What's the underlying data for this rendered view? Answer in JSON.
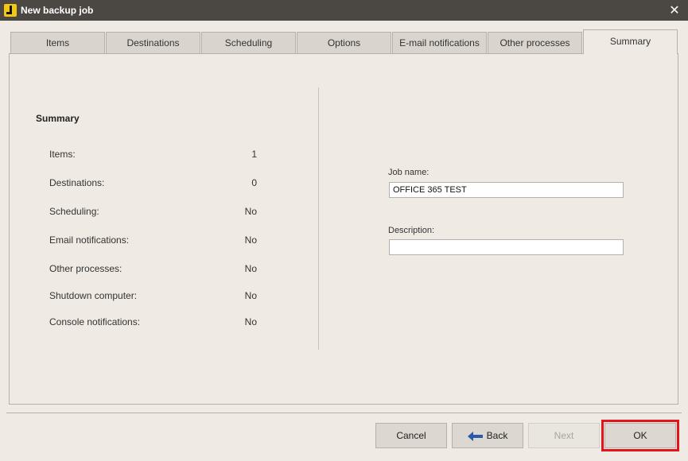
{
  "window": {
    "title": "New backup job",
    "close_glyph": "✕"
  },
  "tabs": [
    {
      "label": "Items"
    },
    {
      "label": "Destinations"
    },
    {
      "label": "Scheduling"
    },
    {
      "label": "Options"
    },
    {
      "label": "E-mail notifications"
    },
    {
      "label": "Other processes"
    },
    {
      "label": "Summary",
      "active": true
    }
  ],
  "summary": {
    "title": "Summary",
    "rows": [
      {
        "label": "Items:",
        "value": "1"
      },
      {
        "label": "Destinations:",
        "value": "0"
      },
      {
        "label": "Scheduling:",
        "value": "No"
      },
      {
        "label": "Email notifications:",
        "value": "No"
      },
      {
        "label": "Other processes:",
        "value": "No"
      },
      {
        "label": "Shutdown computer:",
        "value": "No"
      },
      {
        "label": "Console notifications:",
        "value": "No"
      }
    ]
  },
  "job": {
    "name_label": "Job name:",
    "name_value": "OFFICE 365 TEST",
    "description_label": "Description:",
    "description_value": ""
  },
  "buttons": {
    "cancel": "Cancel",
    "back": "Back",
    "next": "Next",
    "ok": "OK"
  },
  "colors": {
    "highlight": "#e3141c",
    "back_arrow": "#2a5aa8"
  },
  "icons": {
    "app": "backup-app-icon",
    "back": "left-arrow-icon",
    "close": "close-icon"
  }
}
